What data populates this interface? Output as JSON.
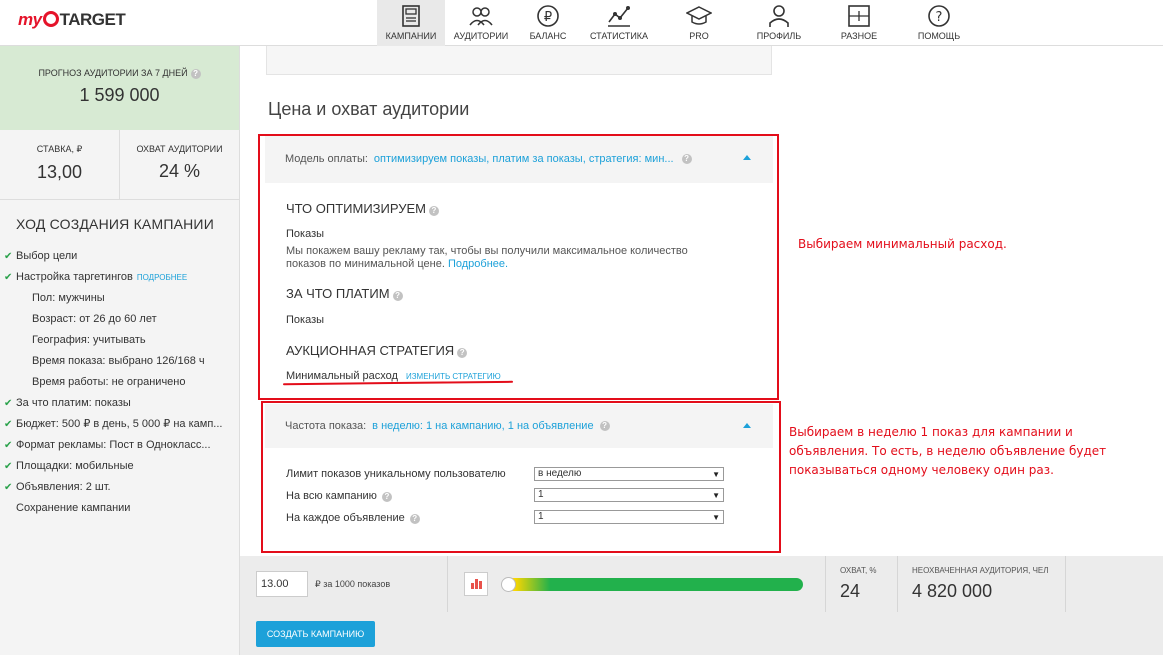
{
  "logo": {
    "my": "my",
    "target": "TARGET"
  },
  "nav": [
    {
      "label": "Кампании",
      "icon": "campaigns-icon"
    },
    {
      "label": "Аудитории",
      "icon": "audiences-icon"
    },
    {
      "label": "Баланс",
      "icon": "ruble-icon"
    },
    {
      "label": "Статистика",
      "icon": "stats-icon"
    },
    {
      "label": "PRO",
      "icon": "graduation-cap-icon"
    },
    {
      "label": "Профиль",
      "icon": "profile-icon"
    },
    {
      "label": "Разное",
      "icon": "misc-icon"
    },
    {
      "label": "Помощь",
      "icon": "help-icon"
    }
  ],
  "sidebar": {
    "forecast_label": "ПРОГНОЗ АУДИТОРИИ ЗА 7 ДНЕЙ",
    "forecast_value": "1 599 000",
    "rate_label": "СТАВКА, ₽",
    "rate_value": "13,00",
    "reach_label": "ОХВАТ АУДИТОРИИ",
    "reach_value": "24 %",
    "progress_title": "ХОД СОЗДАНИЯ КАМПАНИИ",
    "more_link": "ПОДРОБНЕЕ",
    "steps": [
      "Выбор цели",
      "Настройка таргетингов",
      "Пол: мужчины",
      "Возраст: от 26 до 60 лет",
      "География: учитывать",
      "Время показа: выбрано 126/168 ч",
      "Время работы: не ограничено",
      "За что платим: показы",
      "Бюджет: 500 ₽ в день, 5 000 ₽ на камп...",
      "Формат рекламы: Пост в Однокласс...",
      "Площадки: мобильные",
      "Объявления: 2 шт.",
      "Сохранение кампании"
    ]
  },
  "main": {
    "section_title": "Цена и охват аудитории",
    "payment": {
      "label": "Модель оплаты:",
      "value": "оптимизируем показы, платим за показы, стратегия: мин...",
      "optimize_title": "ЧТО ОПТИМИЗИРУЕМ",
      "optimize_value": "Показы",
      "optimize_desc": "Мы покажем вашу рекламу так, чтобы вы получили максимальное количество показов по минимальной цене.",
      "more": "Подробнее.",
      "pay_title": "ЗА ЧТО ПЛАТИМ",
      "pay_value": "Показы",
      "strategy_title": "АУКЦИОННАЯ СТРАТЕГИЯ",
      "strategy_value": "Минимальный расход",
      "strategy_change": "ИЗМЕНИТЬ СТРАТЕГИЮ"
    },
    "frequency": {
      "label": "Частота показа:",
      "value": "в неделю: 1 на кампанию, 1 на объявление",
      "limit_label": "Лимит показов уникальному пользователю",
      "limit_value": "в неделю",
      "campaign_label": "На всю кампанию",
      "campaign_value": "1",
      "ad_label": "На каждое объявление",
      "ad_value": "1"
    },
    "annotation1": "Выбираем минимальный расход.",
    "annotation2": "Выбираем в неделю 1 показ для кампании и объявления. То есть, в неделю объявление будет показываться одному человеку один раз."
  },
  "bottom": {
    "price_value": "13.00",
    "price_unit": "₽ за 1000 показов",
    "reach_pct_label": "ОХВАТ, %",
    "reach_pct_value": "24",
    "uncovered_label": "НЕОХВАЧЕННАЯ АУДИТОРИЯ, ЧЕЛ",
    "uncovered_value": "4 820 000",
    "create_button": "СОЗДАТЬ КАМПАНИЮ"
  },
  "colors": {
    "accent": "#1da1d9",
    "annotation": "#e30d1a",
    "brand": "#e5132a",
    "forecast_bg": "#d7ead3"
  }
}
